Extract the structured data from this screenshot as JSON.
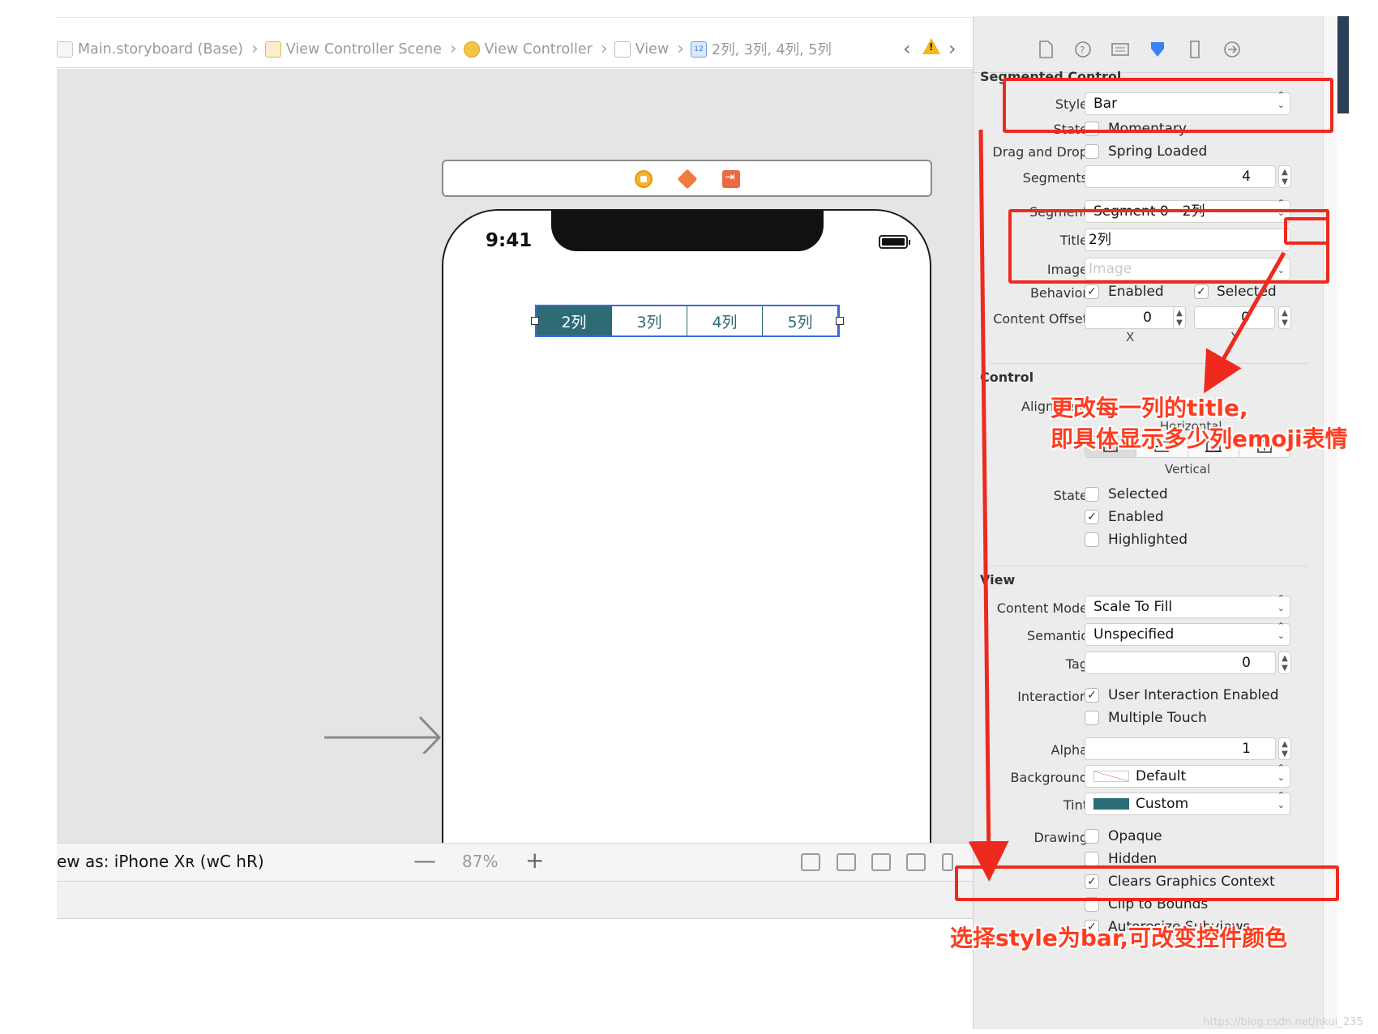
{
  "jumpbar": {
    "crumbs": [
      "Main.storyboard (Base)",
      "View Controller Scene",
      "View Controller",
      "View",
      "2列, 3列, 4列, 5列"
    ]
  },
  "canvas": {
    "bottom": {
      "view_as": "ew as: iPhone Xʀ (wC hR)",
      "zoom": "87%",
      "zoom_out": "—",
      "zoom_in": "+"
    },
    "phone": {
      "time": "9:41",
      "segments": [
        "2列",
        "3列",
        "4列",
        "5列"
      ],
      "selected_index": 0
    }
  },
  "inspector": {
    "segmented_control": {
      "title": "Segmented Control",
      "style_label": "Style",
      "style_value": "Bar",
      "state_label": "State",
      "momentary": "Momentary",
      "drag_drop_label": "Drag and Drop",
      "spring_loaded": "Spring Loaded",
      "segments_label": "Segments",
      "segments_value": "4",
      "segment_label": "Segment",
      "segment_value": "Segment 0 - 2列",
      "title_label": "Title",
      "title_value": "2列",
      "image_label": "Image",
      "image_placeholder": "Image",
      "behavior_label": "Behavior",
      "enabled": "Enabled",
      "selected": "Selected",
      "content_offset_label": "Content Offset",
      "offset_x": "0",
      "offset_y": "0",
      "x_caption": "X",
      "y_caption": "Y"
    },
    "control": {
      "title": "Control",
      "alignment_label": "Alignment",
      "horizontal": "Horizontal",
      "vertical": "Vertical",
      "state_label": "State",
      "selected": "Selected",
      "enabled": "Enabled",
      "highlighted": "Highlighted"
    },
    "view": {
      "title": "View",
      "content_mode_label": "Content Mode",
      "content_mode_value": "Scale To Fill",
      "semantic_label": "Semantic",
      "semantic_value": "Unspecified",
      "tag_label": "Tag",
      "tag_value": "0",
      "interaction_label": "Interaction",
      "user_interaction": "User Interaction Enabled",
      "multiple_touch": "Multiple Touch",
      "alpha_label": "Alpha",
      "alpha_value": "1",
      "background_label": "Background",
      "background_value": "Default",
      "tint_label": "Tint",
      "tint_value": "Custom",
      "drawing_label": "Drawing",
      "opaque": "Opaque",
      "hidden": "Hidden",
      "clears_graphics": "Clears Graphics Context",
      "clip_bounds": "Clip to Bounds",
      "autoresize": "Autoresize Subviews"
    }
  },
  "annotations": {
    "title_note_line1": "更改每一列的title,",
    "title_note_line2": "即具体显示多少列emoji表情",
    "style_note": "选择style为bar,可改变控件颜色"
  },
  "watermark": "https://blog.csdn.net/nkui_235",
  "colors": {
    "tint": "#2d6c74",
    "annotation_red": "#ee2a1e",
    "selection_blue": "#3a6be0"
  }
}
